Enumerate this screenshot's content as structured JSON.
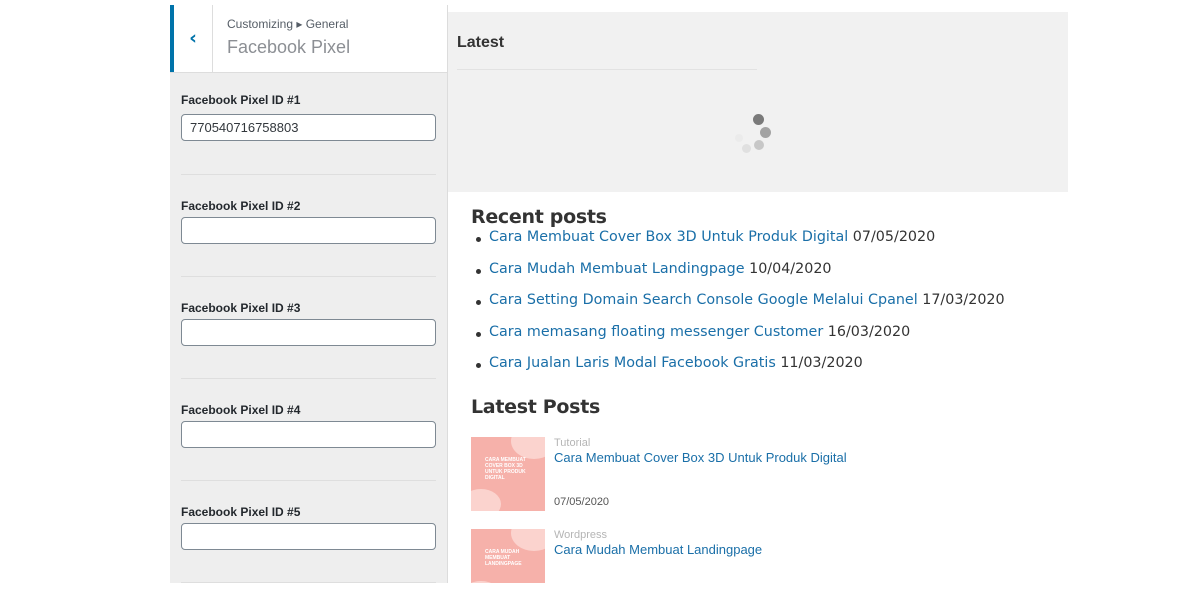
{
  "sidebar": {
    "breadcrumb": "Customizing ▸ General",
    "title": "Facebook Pixel",
    "fields": [
      {
        "label": "Facebook Pixel ID #1",
        "value": "770540716758803"
      },
      {
        "label": "Facebook Pixel ID #2",
        "value": ""
      },
      {
        "label": "Facebook Pixel ID #3",
        "value": ""
      },
      {
        "label": "Facebook Pixel ID #4",
        "value": ""
      },
      {
        "label": "Facebook Pixel ID #5",
        "value": ""
      }
    ]
  },
  "preview": {
    "latest_title": "Latest",
    "recent_title": "Recent posts",
    "recent_posts": [
      {
        "title": "Cara Membuat Cover Box 3D Untuk Produk Digital",
        "date": "07/05/2020"
      },
      {
        "title": "Cara Mudah Membuat Landingpage",
        "date": "10/04/2020"
      },
      {
        "title": "Cara Setting Domain Search Console Google Melalui Cpanel",
        "date": "17/03/2020"
      },
      {
        "title": "Cara memasang floating messenger Customer",
        "date": "16/03/2020"
      },
      {
        "title": "Cara Jualan Laris Modal Facebook Gratis",
        "date": "11/03/2020"
      }
    ],
    "latest_posts_title": "Latest Posts",
    "latest_posts": [
      {
        "category": "Tutorial",
        "title": "Cara Membuat Cover Box 3D Untuk Produk Digital",
        "date": "07/05/2020",
        "thumb_text": "Cara Membuat Cover Box 3D Untuk Produk Digital"
      },
      {
        "category": "Wordpress",
        "title": "Cara Mudah Membuat Landingpage",
        "date": "",
        "thumb_text": "Cara Mudah Membuat Landingpage"
      }
    ]
  },
  "colors": {
    "accent": "#0073aa",
    "link": "#1a6fa8",
    "thumb": "#f6b1aa"
  },
  "icons": {
    "back": "chevron-left-icon",
    "loading": "spinner-icon"
  }
}
